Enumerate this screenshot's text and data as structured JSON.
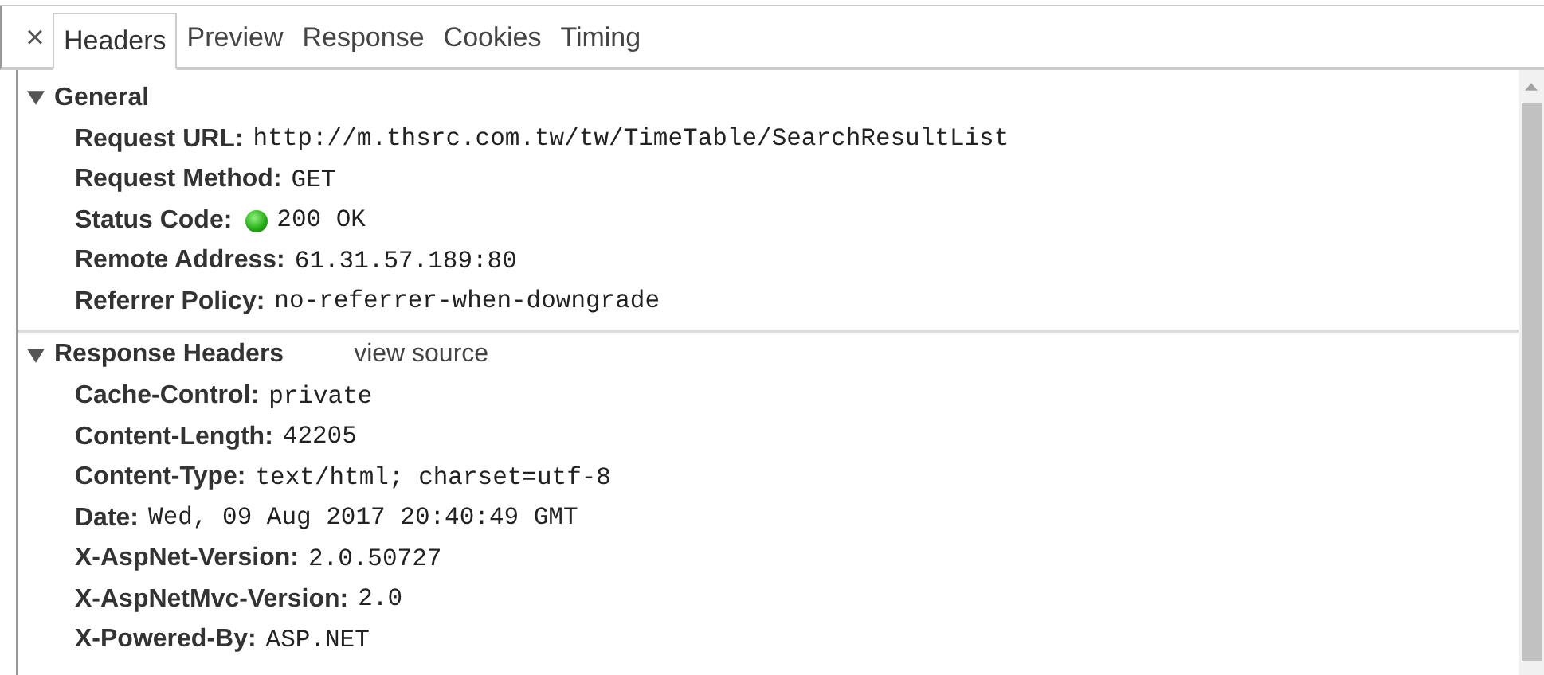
{
  "close_label": "×",
  "tabs": [
    {
      "label": "Headers",
      "selected": true
    },
    {
      "label": "Preview",
      "selected": false
    },
    {
      "label": "Response",
      "selected": false
    },
    {
      "label": "Cookies",
      "selected": false
    },
    {
      "label": "Timing",
      "selected": false
    }
  ],
  "sections": [
    {
      "title": "General",
      "expanded": true,
      "rows": [
        {
          "name": "Request URL:",
          "value": "http://m.thsrc.com.tw/tw/TimeTable/SearchResultList"
        },
        {
          "name": "Request Method:",
          "value": "GET"
        },
        {
          "name": "Status Code:",
          "value": "200 OK",
          "kind": "status"
        },
        {
          "name": "Remote Address:",
          "value": "61.31.57.189:80"
        },
        {
          "name": "Referrer Policy:",
          "value": "no-referrer-when-downgrade"
        }
      ]
    },
    {
      "title": "Response Headers",
      "link": "view source",
      "expanded": true,
      "rows": [
        {
          "name": "Cache-Control:",
          "value": "private"
        },
        {
          "name": "Content-Length:",
          "value": "42205"
        },
        {
          "name": "Content-Type:",
          "value": "text/html; charset=utf-8"
        },
        {
          "name": "Date:",
          "value": "Wed, 09 Aug 2017 20:40:49 GMT"
        },
        {
          "name": "X-AspNet-Version:",
          "value": "2.0.50727"
        },
        {
          "name": "X-AspNetMvc-Version:",
          "value": "2.0"
        },
        {
          "name": "X-Powered-By:",
          "value": "ASP.NET"
        }
      ]
    }
  ]
}
